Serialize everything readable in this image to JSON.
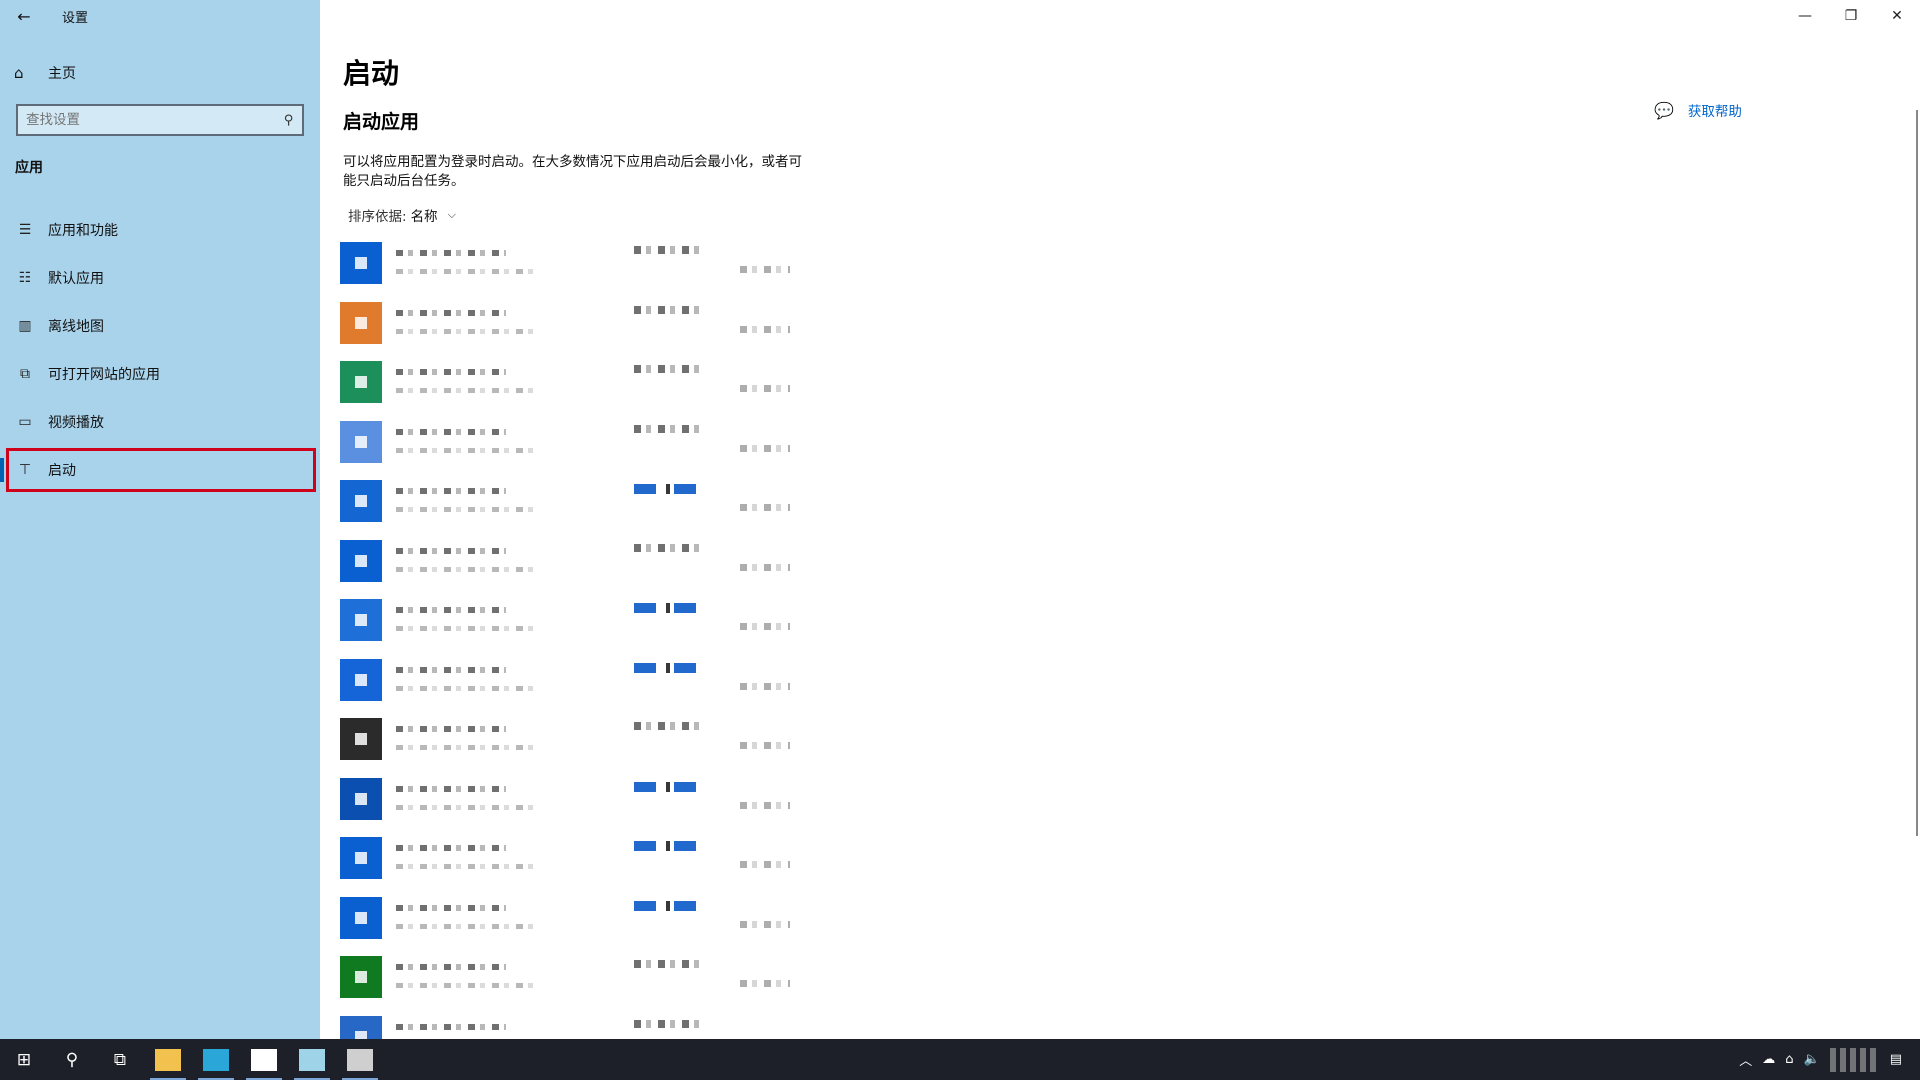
{
  "window": {
    "title": "设置",
    "back_icon": "←",
    "minimize_icon": "—",
    "restore_icon": "❐",
    "close_icon": "✕"
  },
  "sidebar": {
    "home_icon": "⌂",
    "home_label": "主页",
    "search_placeholder": "查找设置",
    "search_icon": "⚲",
    "section_label": "应用",
    "items": [
      {
        "icon": "☰",
        "label": "应用和功能"
      },
      {
        "icon": "☷",
        "label": "默认应用"
      },
      {
        "icon": "▥",
        "label": "离线地图"
      },
      {
        "icon": "⧉",
        "label": "可打开网站的应用"
      },
      {
        "icon": "▭",
        "label": "视频播放"
      },
      {
        "icon": "⊤",
        "label": "启动"
      }
    ]
  },
  "main": {
    "title": "启动",
    "subtitle": "启动应用",
    "description": "可以将应用配置为登录时启动。在大多数情况下应用启动后会最小化，或者可能只启动后台任务。",
    "sort_label": "排序依据:",
    "sort_value": "名称",
    "sort_chevron": "⌵",
    "help_icon": "💬",
    "help_label": "获取帮助",
    "apps": [
      {
        "icon_color": "#0a5fd1",
        "toggle": "off"
      },
      {
        "icon_color": "#e07a2c",
        "toggle": "off"
      },
      {
        "icon_color": "#1d8f5a",
        "toggle": "off"
      },
      {
        "icon_color": "#5b8fe0",
        "toggle": "off"
      },
      {
        "icon_color": "#1467d3",
        "toggle": "on"
      },
      {
        "icon_color": "#0a5fd1",
        "toggle": "off"
      },
      {
        "icon_color": "#1f6fd8",
        "toggle": "on"
      },
      {
        "icon_color": "#1565d8",
        "toggle": "on"
      },
      {
        "icon_color": "#2b2b2b",
        "toggle": "off"
      },
      {
        "icon_color": "#0b4fb0",
        "toggle": "on"
      },
      {
        "icon_color": "#0a5fd1",
        "toggle": "on"
      },
      {
        "icon_color": "#0a5fd1",
        "toggle": "on"
      },
      {
        "icon_color": "#0f7a20",
        "toggle": "off"
      },
      {
        "icon_color": "#2767c6",
        "toggle": "off"
      }
    ]
  },
  "taskbar": {
    "start_icon": "⊞",
    "search_icon": "⚲",
    "taskview_icon": "⧉",
    "apps": [
      {
        "name": "file-explorer",
        "color": "#f2c14e",
        "running": true
      },
      {
        "name": "edge",
        "color": "#2aa6d8",
        "running": true
      },
      {
        "name": "app-3",
        "color": "#ffffff",
        "running": true
      },
      {
        "name": "app-4",
        "color": "#9fd4e8",
        "running": true
      },
      {
        "name": "settings",
        "color": "#cfcfcf",
        "running": true
      }
    ],
    "tray_chevron": "︿",
    "tray_cloud": "☁",
    "tray_network": "⌂",
    "tray_volume": "🔈",
    "tray_notify": "▤"
  }
}
